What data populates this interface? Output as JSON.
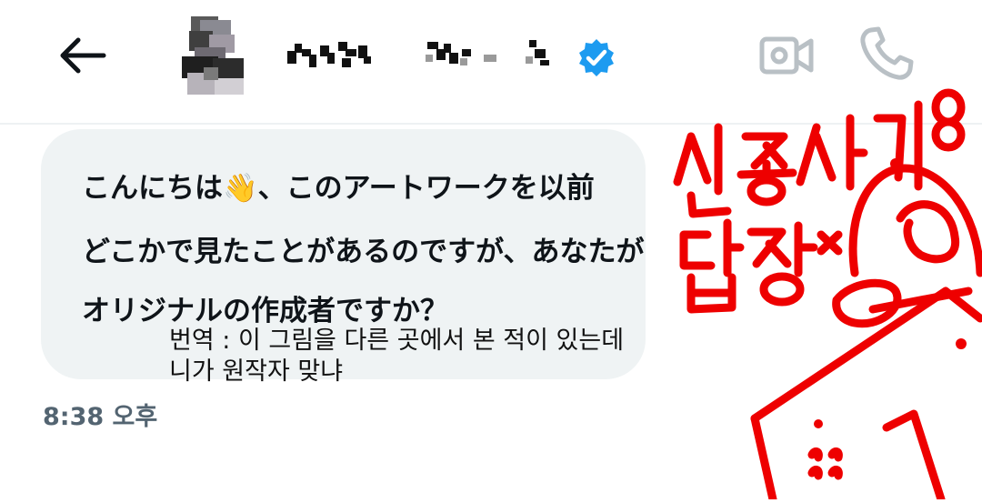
{
  "header": {
    "back_icon": "arrow-left-icon",
    "avatar": "blurred-avatar",
    "display_name": "(pixelated)",
    "verified_icon": "verified-badge-icon",
    "video_icon": "video-camera-icon",
    "call_icon": "phone-icon",
    "colors": {
      "verified": "#1d9bf0",
      "icon_gray": "#b9c0c5"
    }
  },
  "message": {
    "lines": [
      "こんにちは",
      "、このアートワークを以前",
      "どこかで見たことがあるのですが、あなたが",
      "オリジナルの作成者ですか？"
    ],
    "wave_emoji": "👋",
    "time": "8:38 오후",
    "bubble_color": "#eff3f4"
  },
  "caption": {
    "line1": "번역 : 이 그림을 다른 곳에서 본 적이 있는데",
    "line2": "니가 원작자 맞냐"
  },
  "annotation": {
    "text_top": "신종사기 ㅇㅇ",
    "text_bottom": "답장 ×",
    "color": "#ee0000"
  }
}
